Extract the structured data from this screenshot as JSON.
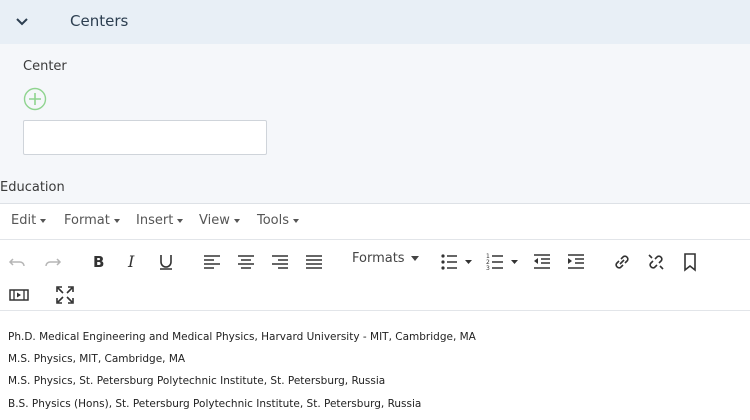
{
  "section": {
    "title": "Centers"
  },
  "center": {
    "label": "Center",
    "value": ""
  },
  "education": {
    "label": "Education",
    "menu": [
      "Edit",
      "Format",
      "Insert",
      "View",
      "Tools"
    ],
    "formats_label": "Formats",
    "icons": [
      "undo-icon",
      "redo-icon",
      "bold-icon",
      "italic-icon",
      "underline-icon",
      "align-left-icon",
      "align-center-icon",
      "align-right-icon",
      "align-justify-icon",
      "bullet-list-icon",
      "numbered-list-icon",
      "outdent-icon",
      "indent-icon",
      "link-icon",
      "unlink-icon",
      "bookmark-icon",
      "media-icon",
      "fullscreen-icon"
    ],
    "lines": [
      "Ph.D. Medical Engineering and Medical Physics, Harvard University - MIT, Cambridge, MA",
      "M.S. Physics, MIT, Cambridge, MA",
      "M.S. Physics, St. Petersburg Polytechnic Institute, St. Petersburg, Russia",
      "B.S. Physics (Hons), St. Petersburg Polytechnic Institute, St. Petersburg, Russia"
    ]
  },
  "colors": {
    "header_bg": "#e8eff6",
    "add_icon": "#8fd48f"
  }
}
